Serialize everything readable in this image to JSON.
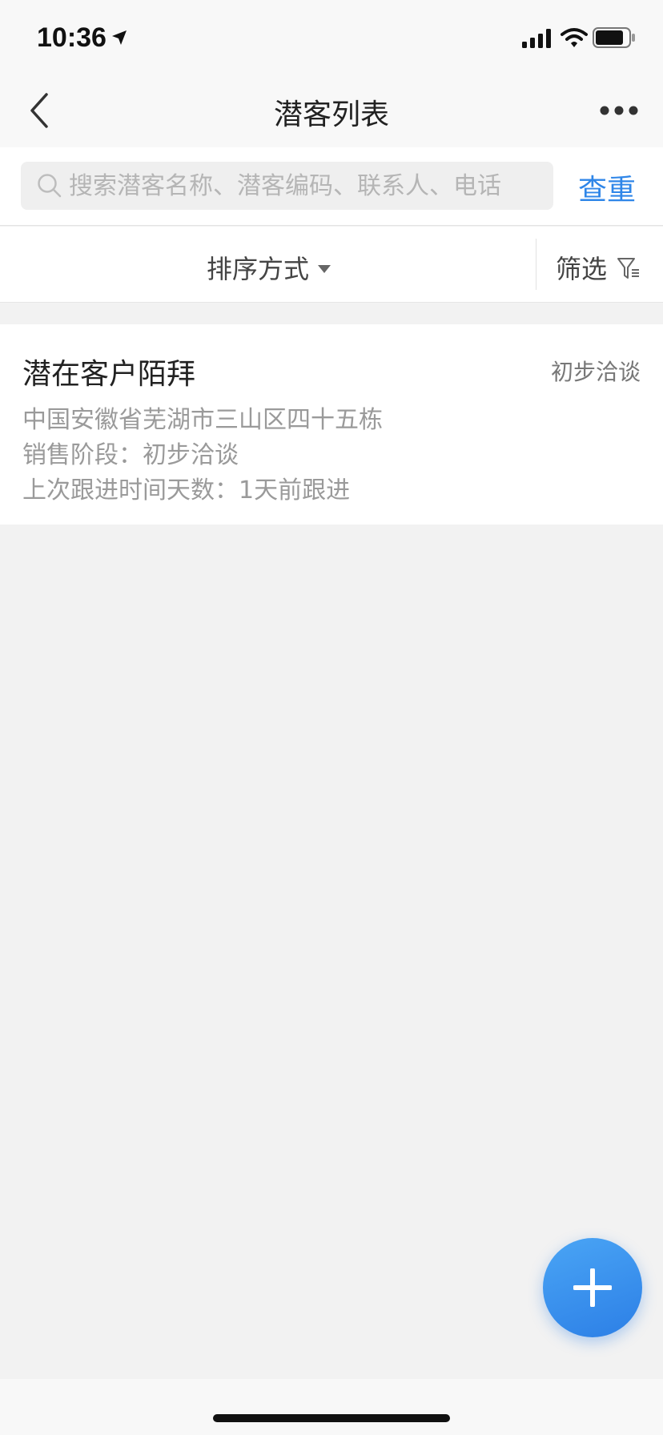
{
  "status_bar": {
    "time": "10:36"
  },
  "nav": {
    "title": "潜客列表"
  },
  "search": {
    "placeholder": "搜索潜客名称、潜客编码、联系人、电话",
    "value": "",
    "dedup_label": "查重"
  },
  "toolbar": {
    "sort_label": "排序方式",
    "filter_label": "筛选"
  },
  "list": {
    "items": [
      {
        "name": "潜在客户陌拜",
        "stage_tag": "初步洽谈",
        "address": "中国安徽省芜湖市三山区四十五栋",
        "stage_line": "销售阶段：初步洽谈",
        "followup_line": "上次跟进时间天数：1天前跟进"
      }
    ]
  },
  "colors": {
    "accent": "#2f86e8",
    "fab": "#3a92ee",
    "background": "#f2f2f2"
  },
  "icons": {
    "back": "chevron-left-icon",
    "more": "more-horizontal-icon",
    "search": "search-icon",
    "sort_caret": "caret-down-icon",
    "filter": "filter-icon",
    "fab": "plus-icon"
  }
}
